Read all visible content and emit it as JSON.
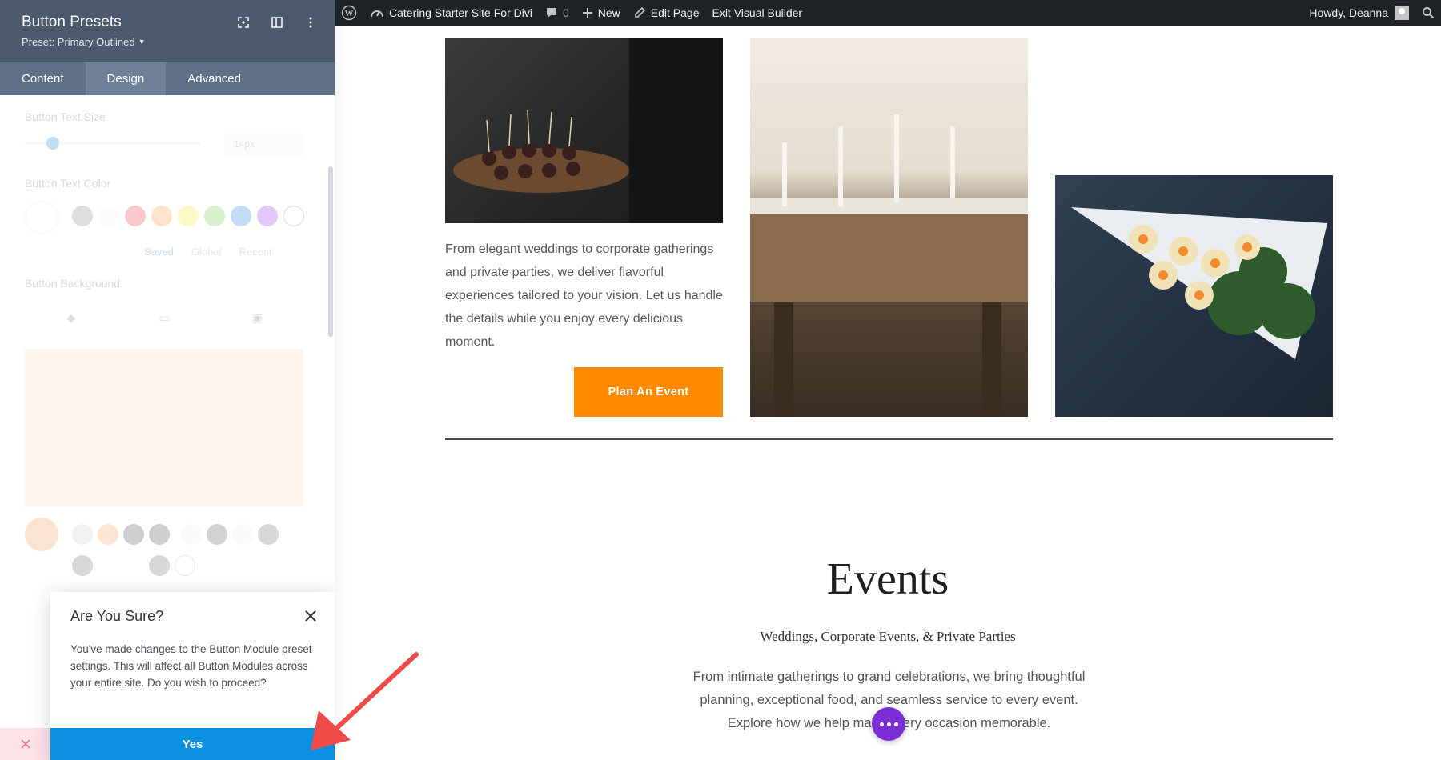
{
  "admin_bar": {
    "site_name": "Catering Starter Site For Divi",
    "comments_count": "0",
    "new_label": "New",
    "edit_label": "Edit Page",
    "exit_label": "Exit Visual Builder",
    "howdy": "Howdy, Deanna"
  },
  "panel": {
    "title": "Button Presets",
    "preset": "Preset: Primary Outlined",
    "tabs": [
      "Content",
      "Design",
      "Advanced"
    ],
    "active_tab": "Design",
    "fields": {
      "text_size_label": "Button Text Size",
      "text_size_value": "14px",
      "text_color_label": "Button Text Color",
      "swatch_tabs": [
        "Saved",
        "Global",
        "Recent"
      ],
      "background_label": "Button Background",
      "background_color": "#ffd9bc"
    }
  },
  "dialog": {
    "title": "Are You Sure?",
    "message": "You've made changes to the Button Module preset settings. This will affect all Button Modules across your entire site. Do you wish to proceed?",
    "confirm_label": "Yes"
  },
  "page": {
    "intro_text": "From elegant weddings to corporate gatherings and private parties, we deliver flavorful experiences tailored to your vision. Let us handle the details while you enjoy every delicious moment.",
    "cta_label": "Plan An Event",
    "events_title": "Events",
    "events_subtitle": "Weddings, Corporate Events, & Private Parties",
    "events_description": "From intimate gatherings to grand celebrations, we bring thoughtful planning, exceptional food, and seamless service to every event. Explore how we help make every occasion memorable."
  },
  "colors": {
    "admin_bar": "#1d2327",
    "panel_header": "#4d5a6d",
    "cta": "#ff8a00",
    "dialog_button": "#0b8fe0",
    "fab": "#7b2ed6"
  }
}
